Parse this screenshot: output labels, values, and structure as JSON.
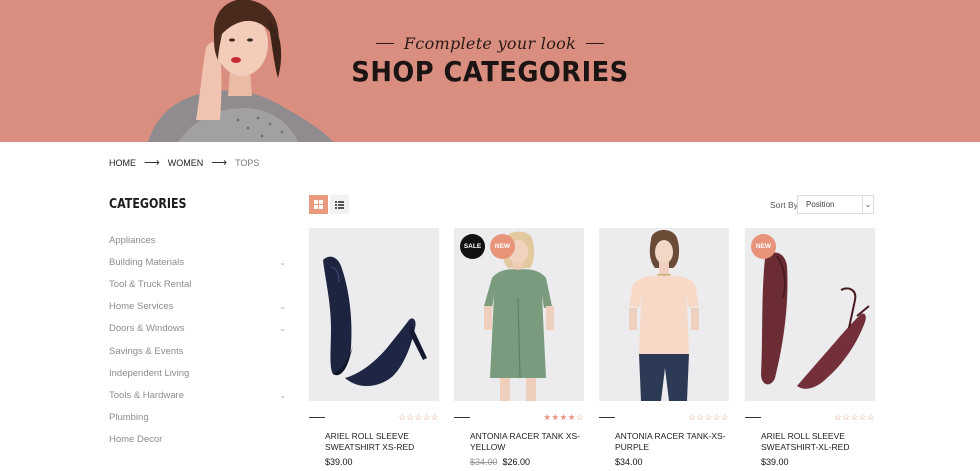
{
  "banner": {
    "tagline": "Fcomplete your look",
    "title": "SHOP CATEGORIES"
  },
  "breadcrumb": {
    "items": [
      "HOME",
      "WOMEN",
      "TOPS"
    ]
  },
  "sidebar": {
    "title": "CATEGORIES",
    "items": [
      {
        "label": "Appliances",
        "expandable": false
      },
      {
        "label": "Building Materials",
        "expandable": true
      },
      {
        "label": "Tool & Truck Rental",
        "expandable": false
      },
      {
        "label": "Home Services",
        "expandable": true
      },
      {
        "label": "Doors & Windows",
        "expandable": true
      },
      {
        "label": "Savings & Events",
        "expandable": false
      },
      {
        "label": "Independent Living",
        "expandable": false
      },
      {
        "label": "Tools & Hardware",
        "expandable": true
      },
      {
        "label": "Plumbing",
        "expandable": false
      },
      {
        "label": "Home Decor",
        "expandable": false
      }
    ]
  },
  "toolbar": {
    "sort_label": "Sort By",
    "sort_value": "Position",
    "view_modes": [
      "grid-icon",
      "list-icon"
    ]
  },
  "products": [
    {
      "name": "ARIEL ROLL SLEEVE SWEATSHIRT XS-RED",
      "price": "$39.00",
      "old_price": "",
      "rating": 0,
      "badges": [],
      "image": "navy-high-heel-shoes"
    },
    {
      "name": "ANTONIA RACER TANK XS-YELLOW",
      "price": "$26.00",
      "old_price": "$34.00",
      "rating": 4,
      "badges": [
        "SALE",
        "NEW"
      ],
      "image": "sage-green-dress-model"
    },
    {
      "name": "ANTONIA RACER TANK-XS-PURPLE",
      "price": "$34.00",
      "old_price": "",
      "rating": 0,
      "badges": [],
      "image": "peach-top-model"
    },
    {
      "name": "ARIEL ROLL SLEEVE SWEATSHIRT-XL-RED",
      "price": "$39.00",
      "old_price": "",
      "rating": 0,
      "badges": [
        "NEW"
      ],
      "image": "burgundy-strap-flats"
    }
  ],
  "colors": {
    "banner_bg": "#d98e80",
    "accent": "#e8937a",
    "sale_badge": "#111111"
  }
}
